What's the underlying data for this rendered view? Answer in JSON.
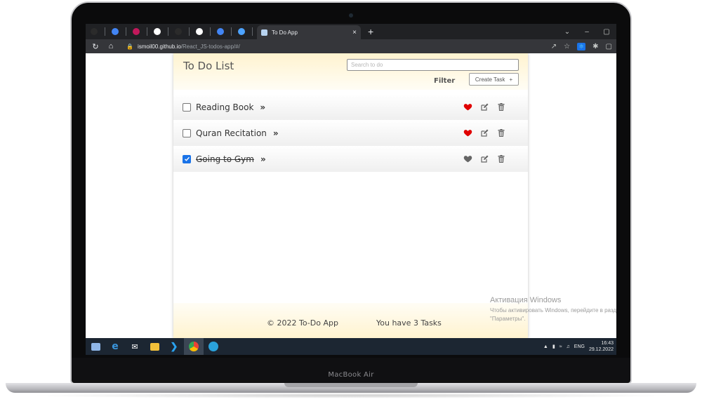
{
  "browser": {
    "active_tab_title": "To Do App",
    "close_tab_glyph": "×",
    "new_tab_glyph": "+",
    "window_controls": [
      "⌄",
      "–",
      "▢"
    ],
    "url_host": "ismoil00.github.io",
    "url_path": "/React_JS-todos-app/#/",
    "pinned_tab_colors": [
      "#2b2b2b",
      "#4285f4",
      "#c2185b",
      "#ffffff",
      "#2b2b2b",
      "#ffffff",
      "#4285f4",
      "#4da3ff"
    ]
  },
  "app": {
    "title": "To Do List",
    "search_placeholder": "Search to do",
    "filter_label": "Filter",
    "create_button_label": "Create Task",
    "create_button_icon": "+",
    "tasks": [
      {
        "label": "Reading Book",
        "more": "»",
        "checked": false,
        "favorite": true
      },
      {
        "label": "Quran Recitation",
        "more": "»",
        "checked": false,
        "favorite": true
      },
      {
        "label": "Going to Gym",
        "more": "»",
        "checked": true,
        "favorite": false
      }
    ],
    "footer_copyright": "© 2022 To-Do App",
    "footer_count": "You have 3 Tasks"
  },
  "os": {
    "activation_title": "Активация Windows",
    "activation_text": "Чтобы активировать Windows, перейдите в раздел \"Параметры\".",
    "tray_lang": "ENG",
    "clock_time": "16:43",
    "clock_date": "29.12.2022"
  },
  "device": {
    "label": "MacBook Air"
  },
  "colors": {
    "heart_favorite": "#e00000",
    "heart_default": "#666666",
    "checkbox_checked": "#1a73e8",
    "header_gradient": "#fff3cf"
  }
}
